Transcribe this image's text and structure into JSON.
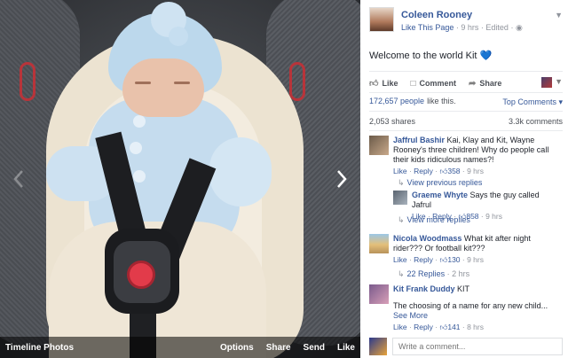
{
  "photo_viewer": {
    "bar_title": "Timeline Photos",
    "actions": [
      "Options",
      "Share",
      "Send",
      "Like"
    ]
  },
  "post": {
    "page_name": "Coleen Rooney",
    "like_page": "Like This Page",
    "time": "9 hrs",
    "edited": "Edited",
    "caption": "Welcome to the world Kit",
    "caption_emoji": "💙",
    "actions": {
      "like": "Like",
      "comment": "Comment",
      "share": "Share"
    },
    "likes_count": "172,657 people",
    "likes_suffix": "like this.",
    "top_comments": "Top Comments",
    "shares": "2,053 shares",
    "comments_count": "3.3k comments"
  },
  "comments": [
    {
      "name": "Jaffrul Bashir",
      "text": "Kai, Klay and Kit, Wayne Rooney's three children! Why do people call their kids ridiculous names?!",
      "like": "Like",
      "reply": "Reply",
      "likes": "358",
      "time": "9 hrs",
      "view_previous": "View previous replies",
      "reply_comment": {
        "name": "Graeme Whyte",
        "text": "Says the guy called Jafrul",
        "like": "Like",
        "reply": "Reply",
        "likes": "858",
        "time": "9 hrs"
      },
      "view_more": "View more replies"
    },
    {
      "name": "Nicola Woodmass",
      "text": "What kit after night rider??? Or football kit???",
      "like": "Like",
      "reply": "Reply",
      "likes": "130",
      "time": "9 hrs",
      "replies_link": "22 Replies",
      "replies_time": "2 hrs"
    },
    {
      "name": "Kit Frank Duddy",
      "text": "KIT",
      "text2": "The choosing of a name for any new child...",
      "see_more": "See More",
      "like": "Like",
      "reply": "Reply",
      "likes": "141",
      "time": "8 hrs"
    }
  ],
  "composer": {
    "placeholder": "Write a comment..."
  }
}
